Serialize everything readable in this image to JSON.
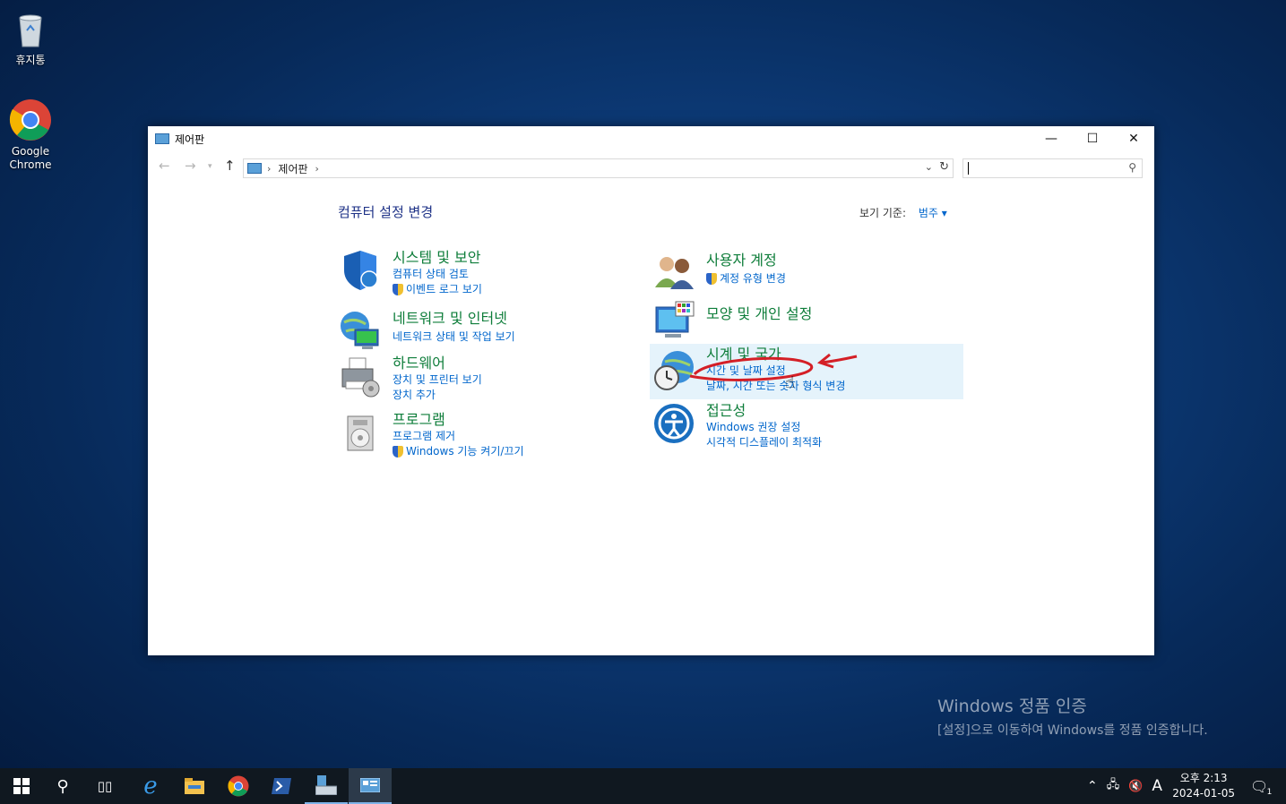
{
  "desktop": {
    "icons": [
      {
        "label": "휴지통"
      },
      {
        "label": "Google Chrome"
      }
    ],
    "activation": {
      "title": "Windows 정품 인증",
      "subtitle": "[설정]으로 이동하여 Windows를 정품 인증합니다."
    }
  },
  "window": {
    "title": "제어판",
    "address": {
      "crumb": "제어판"
    },
    "search": {
      "placeholder": ""
    },
    "heading": "컴퓨터 설정 변경",
    "view_by": {
      "label": "보기 기준:",
      "value": "범주"
    },
    "categories": [
      {
        "title": "시스템 및 보안",
        "links": [
          "컴퓨터 상태 검토",
          "이벤트 로그 보기"
        ]
      },
      {
        "title": "네트워크 및 인터넷",
        "links": [
          "네트워크 상태 및 작업 보기"
        ]
      },
      {
        "title": "하드웨어",
        "links": [
          "장치 및 프린터 보기",
          "장치 추가"
        ]
      },
      {
        "title": "프로그램",
        "links": [
          "프로그램 제거",
          "Windows 기능 켜기/끄기"
        ]
      },
      {
        "title": "사용자 계정",
        "links": [
          "계정 유형 변경"
        ]
      },
      {
        "title": "모양 및 개인 설정",
        "links": []
      },
      {
        "title": "시계 및 국가",
        "links": [
          "시간 및 날짜 설정",
          "날짜, 시간 또는 숫자 형식 변경"
        ]
      },
      {
        "title": "접근성",
        "links": [
          "Windows 권장 설정",
          "시각적 디스플레이 최적화"
        ]
      }
    ]
  },
  "taskbar": {
    "clock": {
      "time": "오후 2:13",
      "date": "2024-01-05"
    },
    "ime": "A",
    "notification_count": "1"
  },
  "colors": {
    "annotation": "#d41f26",
    "category_title": "#0e7d3a",
    "link": "#0066cc"
  }
}
